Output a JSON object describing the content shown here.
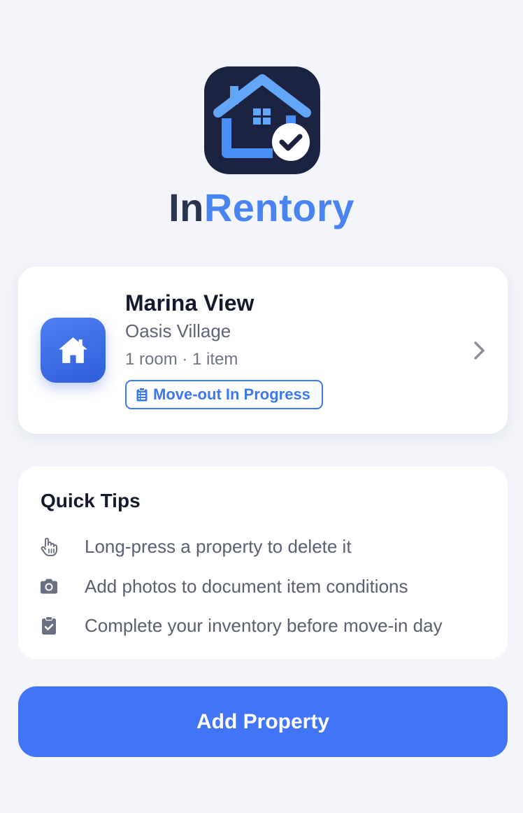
{
  "brand": {
    "name_part1": "In",
    "name_part2": "Rentory",
    "logo_icon": "house-check-icon",
    "colors": {
      "dark": "#2a3450",
      "accent": "#4a84f3",
      "icon_bg": "#1b2340"
    }
  },
  "property": {
    "name": "Marina View",
    "location": "Oasis Village",
    "meta": "1 room · 1 item",
    "status": "Move-out In Progress",
    "icon": "home-icon",
    "status_icon": "clipboard-list-icon",
    "chevron_icon": "chevron-right-icon",
    "status_color": "#3c78ee"
  },
  "tips": {
    "title": "Quick Tips",
    "items": [
      {
        "icon": "hand-pointer-icon",
        "text": "Long-press a property to delete it"
      },
      {
        "icon": "camera-icon",
        "text": "Add photos to document item conditions"
      },
      {
        "icon": "clipboard-check-icon",
        "text": "Complete your inventory before move-in day"
      }
    ]
  },
  "actions": {
    "add_property_label": "Add Property",
    "button_color": "#4275f5"
  }
}
